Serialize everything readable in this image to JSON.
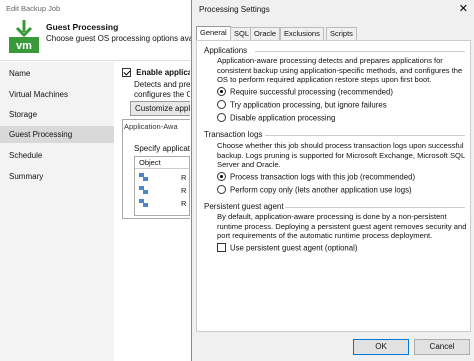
{
  "background_window": {
    "title": "Edit Backup Job",
    "header_title": "Guest Processing",
    "header_subtitle": "Choose guest OS processing options availa",
    "nav": [
      {
        "label": "Name",
        "active": false
      },
      {
        "label": "Virtual Machines",
        "active": false
      },
      {
        "label": "Storage",
        "active": false
      },
      {
        "label": "Guest Processing",
        "active": true
      },
      {
        "label": "Schedule",
        "active": false
      },
      {
        "label": "Summary",
        "active": false
      }
    ],
    "content": {
      "enable_label": "Enable applicatio",
      "detect_line1": "Detects and pre",
      "detect_line2": "configures the O",
      "customize_label": "Customize applic",
      "frame_title": "Application-Awa",
      "specify_label": "Specify applicat",
      "grid_header": "Object",
      "rows": [
        "R",
        "R",
        "R"
      ]
    }
  },
  "dialog": {
    "title": "Processing Settings",
    "close": "✕",
    "tabs": [
      "General",
      "SQL",
      "Oracle",
      "Exclusions",
      "Scripts"
    ],
    "active_tab": "General",
    "applications": {
      "label": "Applications",
      "description": "Application-aware processing detects and prepares applications for consistent backup using application-specific methods, and configures the OS to perform required application restore steps upon first boot.",
      "options": [
        {
          "label": "Require successful processing (recommended)",
          "selected": true
        },
        {
          "label": "Try application processing, but ignore failures",
          "selected": false
        },
        {
          "label": "Disable application processing",
          "selected": false
        }
      ]
    },
    "transaction_logs": {
      "label": "Transaction logs",
      "description": "Choose whether this job should process transaction logs upon successful backup. Logs pruning is supported for Microsoft Exchange, Microsoft SQL Server and Oracle.",
      "options": [
        {
          "label": "Process transaction logs with this job (recommended)",
          "selected": true
        },
        {
          "label": "Perform copy only (lets another application use logs)",
          "selected": false
        }
      ]
    },
    "guest_agent": {
      "label": "Persistent guest agent",
      "description": "By default, application-aware processing is done by a non-persistent runtime process. Deploying a persistent guest agent removes security and port requirements of the automatic runtime process deployment.",
      "checkbox_label": "Use persistent guest agent (optional)",
      "checked": false
    },
    "buttons": {
      "ok": "OK",
      "cancel": "Cancel"
    }
  },
  "colors": {
    "accent": "#0078d7",
    "vm_green": "#3a9a3a",
    "nav_active": "#d9d9d9"
  }
}
